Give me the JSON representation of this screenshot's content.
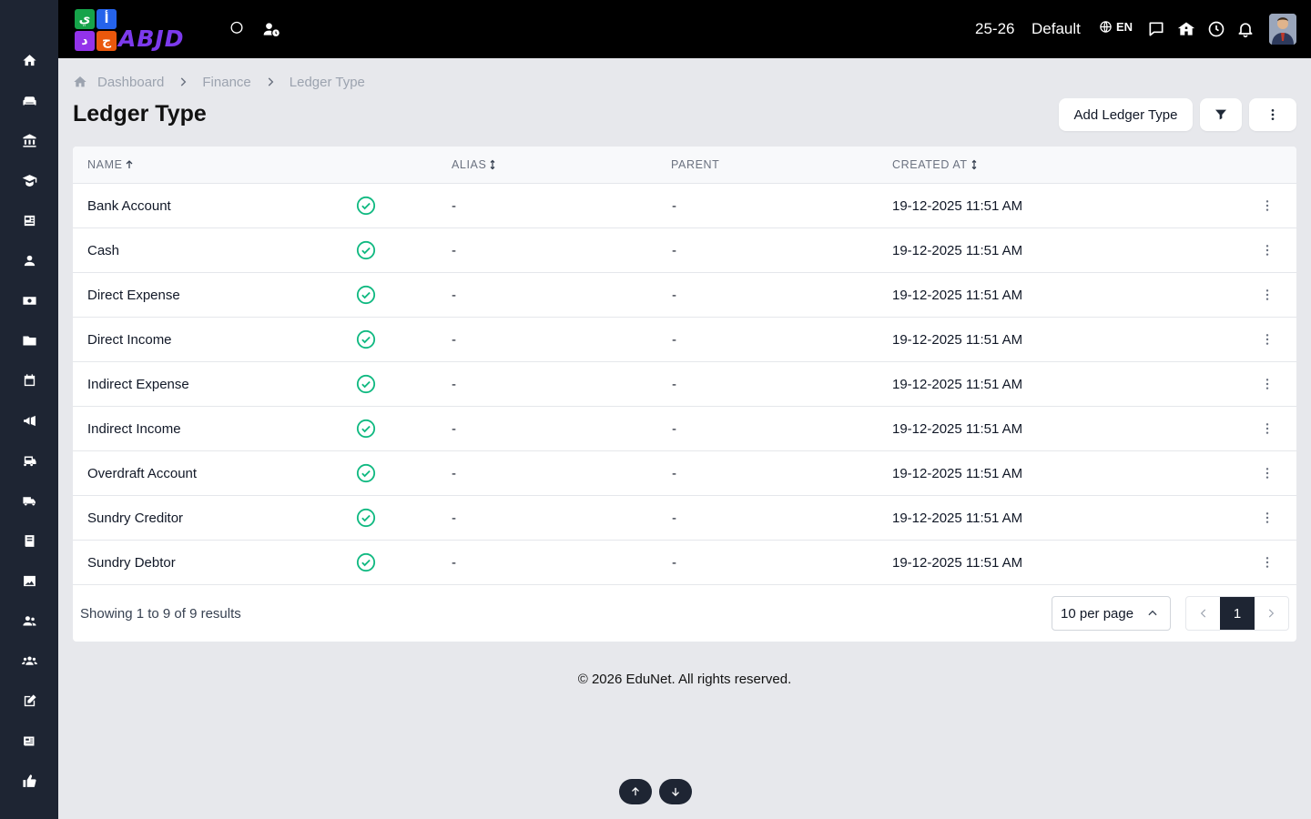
{
  "sidebar": {
    "items": [
      {
        "icon": "home-icon"
      },
      {
        "icon": "sofa-icon"
      },
      {
        "icon": "bank-icon"
      },
      {
        "icon": "graduation-icon"
      },
      {
        "icon": "newspaper-icon"
      },
      {
        "icon": "user-icon"
      },
      {
        "icon": "money-icon"
      },
      {
        "icon": "folder-icon"
      },
      {
        "icon": "calendar-icon"
      },
      {
        "icon": "megaphone-icon"
      },
      {
        "icon": "bus-icon"
      },
      {
        "icon": "truck-icon"
      },
      {
        "icon": "book-icon"
      },
      {
        "icon": "image-icon"
      },
      {
        "icon": "users-icon"
      },
      {
        "icon": "group-icon"
      },
      {
        "icon": "edit-icon"
      },
      {
        "icon": "news-icon"
      },
      {
        "icon": "thumbs-up-icon"
      }
    ]
  },
  "topbar": {
    "logo_text": "ABJD",
    "logo_letters": [
      "ي",
      "أ",
      "د",
      "ج"
    ],
    "session": "25-26",
    "school": "Default",
    "language": "EN"
  },
  "breadcrumb": {
    "items": [
      "Dashboard",
      "Finance",
      "Ledger Type"
    ]
  },
  "page": {
    "title": "Ledger Type",
    "add_button": "Add Ledger Type"
  },
  "table": {
    "columns": [
      "NAME",
      "ALIAS",
      "PARENT",
      "CREATED AT"
    ],
    "rows": [
      {
        "name": "Bank Account",
        "alias": "-",
        "parent": "-",
        "created_at": "19-12-2025 11:51 AM"
      },
      {
        "name": "Cash",
        "alias": "-",
        "parent": "-",
        "created_at": "19-12-2025 11:51 AM"
      },
      {
        "name": "Direct Expense",
        "alias": "-",
        "parent": "-",
        "created_at": "19-12-2025 11:51 AM"
      },
      {
        "name": "Direct Income",
        "alias": "-",
        "parent": "-",
        "created_at": "19-12-2025 11:51 AM"
      },
      {
        "name": "Indirect Expense",
        "alias": "-",
        "parent": "-",
        "created_at": "19-12-2025 11:51 AM"
      },
      {
        "name": "Indirect Income",
        "alias": "-",
        "parent": "-",
        "created_at": "19-12-2025 11:51 AM"
      },
      {
        "name": "Overdraft Account",
        "alias": "-",
        "parent": "-",
        "created_at": "19-12-2025 11:51 AM"
      },
      {
        "name": "Sundry Creditor",
        "alias": "-",
        "parent": "-",
        "created_at": "19-12-2025 11:51 AM"
      },
      {
        "name": "Sundry Debtor",
        "alias": "-",
        "parent": "-",
        "created_at": "19-12-2025 11:51 AM"
      }
    ],
    "status_color": "#10b981",
    "showing": "Showing 1 to 9 of 9 results",
    "per_page": "10 per page",
    "current_page": "1"
  },
  "footer": {
    "copyright": "© 2026 EduNet. All rights reserved."
  }
}
